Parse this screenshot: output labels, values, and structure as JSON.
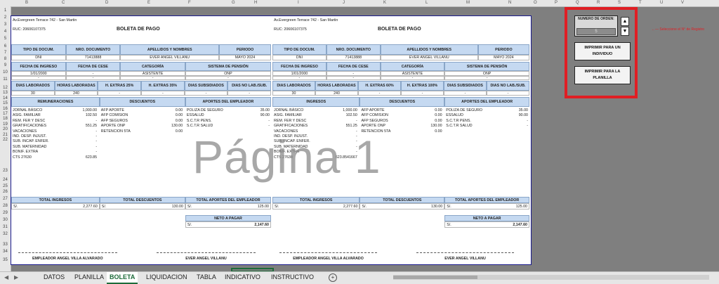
{
  "columns": [
    "B",
    "C",
    "D",
    "E",
    "F",
    "G",
    "H",
    "I",
    "J",
    "K",
    "L",
    "M",
    "N",
    "O",
    "P",
    "Q",
    "R",
    "S",
    "T",
    "U",
    "V"
  ],
  "rows": [
    "1",
    "2",
    "3",
    "4",
    "5",
    "6",
    "7",
    "8",
    "9",
    "10",
    "11",
    "12",
    "13",
    "14",
    "15",
    "16",
    "17",
    "18",
    "19",
    "20",
    "21",
    "22",
    "23",
    "24",
    "25",
    "26",
    "27",
    "28",
    "29",
    "30",
    "31",
    "32",
    "33",
    "34",
    "35"
  ],
  "watermark": "Página 1",
  "left": {
    "address": "Av.Evergreen Terrace 742 - San Martin",
    "ruc": "RUC: 20606107375",
    "title": "BOLETA DE PAGO",
    "hdr_row1": [
      "TIPO DE DOCUM.",
      "NRO. DOCUMENTO",
      "APELLIDOS Y NOMBRES",
      "PERIODO"
    ],
    "val_row1": [
      "DNI",
      "71413888",
      "EVER ANGEL VILLANU",
      "MAYO 2024"
    ],
    "hdr_row2": [
      "FECHA DE INGRESO",
      "FECHA DE CESE",
      "CATEGORÍA",
      "SISTEMA DE PENSIÓN"
    ],
    "val_row2": [
      "1/01/2000",
      "-",
      "ASISTENTE",
      "ONP"
    ],
    "val_row2b": [
      "-",
      "-",
      "-",
      "-"
    ],
    "hdr_row3": [
      "DIAS LABORADOS",
      "HORAS LABORADAS",
      "H. EXTRAS 25%",
      "H. EXTRAS 35%",
      "DIAS SUBSIDIADOS",
      "DIAS NO LAB./SUB."
    ],
    "val_row3": [
      "30",
      "240",
      "-",
      "-",
      "-",
      "-"
    ],
    "sec_hdr": [
      "REMUNERACIONES",
      "DESCUENTOS",
      "APORTES DEL EMPLEADOR"
    ],
    "income": [
      {
        "label": "JORNAL BÁSICO",
        "value": "1,000.00"
      },
      {
        "label": "ASIG. FAMILIAR",
        "value": "102.50"
      },
      {
        "label": "REM. FER Y DESC",
        "value": "-"
      },
      {
        "label": "GRATIFICACIONES",
        "value": "551.25"
      },
      {
        "label": "VACACIONES",
        "value": "-"
      },
      {
        "label": "IND. DESP. INJUST.",
        "value": "-"
      },
      {
        "label": "SUB. INCAP. ENFER.",
        "value": "-"
      },
      {
        "label": "SUB. MATERNIDAD",
        "value": "-"
      },
      {
        "label": "BONIF. EXTRA",
        "value": "-"
      },
      {
        "label": "CTS 27630",
        "value": "623.85"
      }
    ],
    "discounts": [
      {
        "label": "AFP APORTE",
        "value": "0.00"
      },
      {
        "label": "AFP COMISION",
        "value": "0.00"
      },
      {
        "label": "AFP SEGUROS",
        "value": "0.00"
      },
      {
        "label": "APORTE ONP",
        "value": "130.00"
      },
      {
        "label": "RETENCION 5TA",
        "value": "0.00"
      }
    ],
    "employer": [
      {
        "label": "POLIZA DE SEGURO",
        "value": "35.00"
      },
      {
        "label": "ESSALUD",
        "value": "90.00"
      },
      {
        "label": "S.C.T.R PENS.",
        "value": "-"
      },
      {
        "label": "S.C.T.R SALUD",
        "value": "-"
      }
    ],
    "totals_hdr": [
      "TOTAL INGRESOS",
      "TOTAL DESCUENTOS",
      "TOTAL APORTES DEL EMPLEADOR"
    ],
    "currency": "S/.",
    "totals_val": [
      "2,277.60",
      "130.00",
      "125.00"
    ],
    "neto_label": "NETO A PAGAR",
    "neto_val": "2,147.60",
    "sign_employer": "EMPLEADOR ANGEL VILLA ALVARADO",
    "sign_worker": "EVER ANGEL VILLANU"
  },
  "right": {
    "address": "Av.Evergreen Terrace 742 - San Martin",
    "ruc": "RUC: 20606107375",
    "title": "BOLETA DE PAGO",
    "hdr_row1": [
      "TIPO DE DOCUM.",
      "NRO. DOCUMENTO",
      "APELLIDOS Y NOMBRES",
      "PERIODO"
    ],
    "val_row1": [
      "DNI",
      "71413888",
      "EVER ANGEL VILLANU",
      "MAYO 2024"
    ],
    "hdr_row2": [
      "FECHA DE INGRESO",
      "FECHA DE CESE",
      "CATEGORÍA",
      "SISTEMA DE PENSIÓN"
    ],
    "val_row2": [
      "1/01/2000",
      "-",
      "ASISTENTE",
      "ONP"
    ],
    "val_row2b": [
      "-",
      "-",
      "-",
      "-"
    ],
    "hdr_row3": [
      "DIAS LABORADOS",
      "HORAS LABORADAS",
      "H. EXTRAS 60%",
      "H. EXTRAS 100%",
      "DIAS SUBSIDIADOS",
      "DIAS NO LAB./SUB."
    ],
    "val_row3": [
      "30",
      "240",
      "-",
      "-",
      "-",
      "-"
    ],
    "sec_hdr": [
      "INGRESOS",
      "DESCUENTOS",
      "APORTES DEL EMPLEADOR"
    ],
    "income": [
      {
        "label": "JORNAL BÁSICO",
        "value": "1,000.00"
      },
      {
        "label": "ASIG. FAMILIAR",
        "value": "102.50"
      },
      {
        "label": "REM. FER Y DESC",
        "value": "-"
      },
      {
        "label": "GRATIFICACIONES",
        "value": "551.25"
      },
      {
        "label": "VACACIONES",
        "value": "-"
      },
      {
        "label": "IND. DESP. INJUST.",
        "value": "-"
      },
      {
        "label": "SUB. INCAP. ENFER.",
        "value": "-"
      },
      {
        "label": "SUB. MATERNIDAD",
        "value": "-"
      },
      {
        "label": "BONIF. EXTRA",
        "value": "-"
      },
      {
        "label": "CTS 27630",
        "value": "623.8541667"
      }
    ],
    "discounts": [
      {
        "label": "AFP APORTE",
        "value": "0.00"
      },
      {
        "label": "AFP COMISION",
        "value": "0.00"
      },
      {
        "label": "AFP SEGUROS",
        "value": "0.00"
      },
      {
        "label": "APORTE ONP",
        "value": "130.00"
      },
      {
        "label": "RETENCION 5TA",
        "value": "0.00"
      }
    ],
    "employer": [
      {
        "label": "POLIZA DE SEGURO",
        "value": "35.00"
      },
      {
        "label": "ESSALUD",
        "value": "90.00"
      },
      {
        "label": "S.C.T.R PENS.",
        "value": "-"
      },
      {
        "label": "S.C.T.R SALUD",
        "value": "-"
      }
    ],
    "totals_hdr": [
      "TOTAL INGRESOS",
      "TOTAL DESCUENTOS",
      "TOTAL APORTES DEL EMPLEADOR"
    ],
    "currency": "S/.",
    "totals_val": [
      "2,277.60",
      "130.00",
      "125.00"
    ],
    "neto_label": "NETO A PAGAR",
    "neto_val": "2,147.60",
    "sign_employer": "EMPLEADOR ANGEL VILLA ALVARADO",
    "sign_worker": "EVER ANGEL VILLANU"
  },
  "panel": {
    "numero_label": "NUMERO DE ORDEN:",
    "numero_value": "5",
    "note": "Seleccione el N° de Registro",
    "btn_individual": "IMPRIMIR PARA UN INDIVIDUO",
    "btn_planilla": "IMPRIMIR PARA LA PLANILLA",
    "spin_up": "▲",
    "spin_down": "▼"
  },
  "tabs": [
    "DATOS",
    "PLANILLA",
    "BOLETA",
    "LIQUIDACION",
    "TABLA",
    "INDICATIVO",
    "INSTRUCTIVO"
  ],
  "active_tab": "BOLETA",
  "tab_add": "+",
  "colors": {
    "header_fill": "#c5d9f1",
    "panel_border": "#e01e24",
    "active_tab": "#1d6b3a"
  }
}
